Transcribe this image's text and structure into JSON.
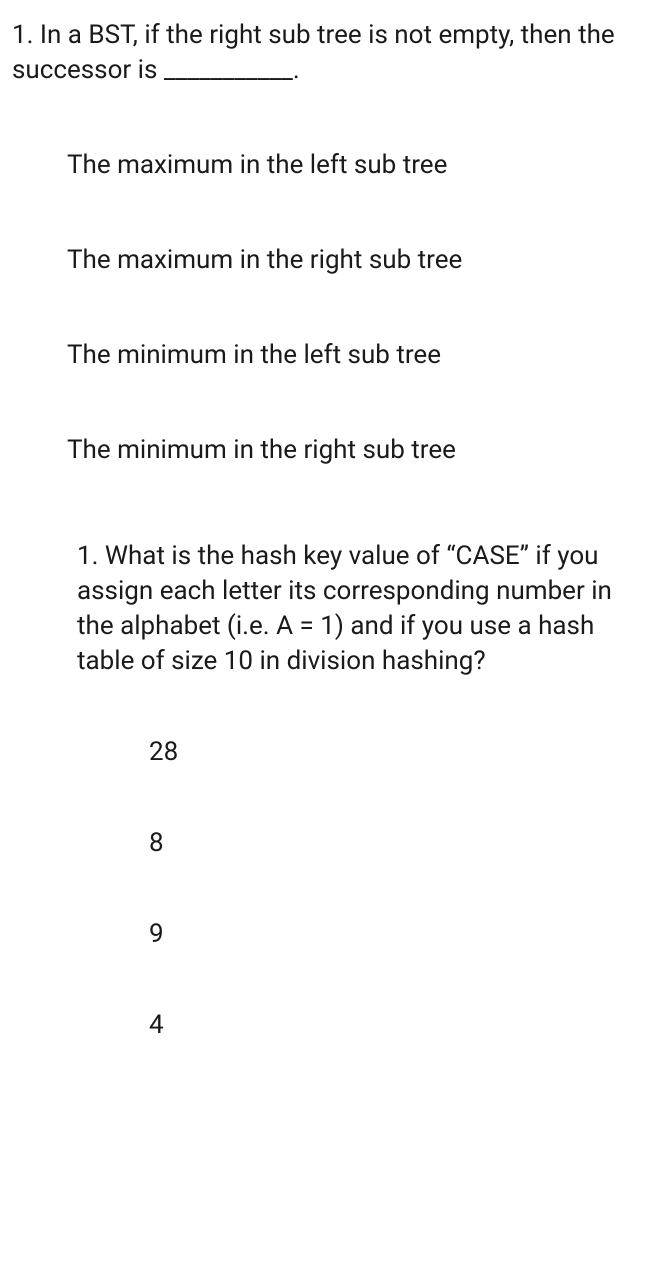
{
  "q1": {
    "number": "1.",
    "text": "In a BST, if the right sub tree is not empty, then the successor is ___________.",
    "options": [
      "The maximum in the left sub tree",
      "The maximum in the right sub tree",
      "The minimum in the left sub tree",
      "The minimum in the right sub tree"
    ]
  },
  "q2": {
    "number": "1.",
    "text": "What is the hash key value of “CASE” if you assign each letter its corresponding number in the alphabet (i.e. A = 1) and if you use a hash table of size 10 in division hashing?",
    "options": [
      "28",
      "8",
      "9",
      "4"
    ]
  }
}
